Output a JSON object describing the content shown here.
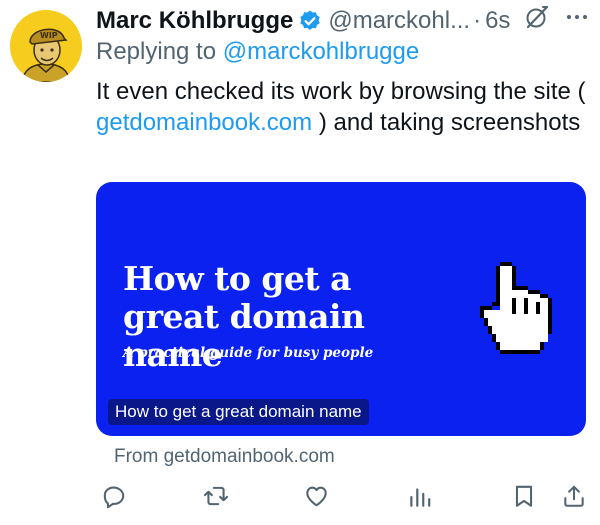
{
  "author": {
    "name": "Marc Köhlbrugge",
    "handle": "@marckohl...",
    "separator": "·",
    "time": "6s",
    "avatar_icon": "avatar-wip-cap-portrait",
    "verified_icon": "verified-badge-icon"
  },
  "reply": {
    "prefix": "Replying to",
    "mention": "@marckohlbrugge"
  },
  "tweet": {
    "text_before": "It even checked its work by browsing the site (",
    "link": "getdomainbook.com",
    "text_after": ") and taking screenshots"
  },
  "card": {
    "title": "How to get a great domain name",
    "subtitle": "A practical guide for busy people",
    "caption": "How to get a great domain name",
    "icon": "pointing-hand-cursor-icon",
    "from_label": "From getdomainbook.com"
  },
  "actions": [
    {
      "name": "reply",
      "icon": "reply-icon"
    },
    {
      "name": "repost",
      "icon": "repost-icon"
    },
    {
      "name": "like",
      "icon": "like-icon"
    },
    {
      "name": "views",
      "icon": "views-icon"
    },
    {
      "name": "bookmark",
      "icon": "bookmark-icon"
    },
    {
      "name": "share",
      "icon": "share-icon"
    }
  ],
  "colors": {
    "accent": "#1d9bf0",
    "muted": "#536471",
    "card_background": "#0a21f0",
    "avatar_background": "#f6cd1e"
  }
}
